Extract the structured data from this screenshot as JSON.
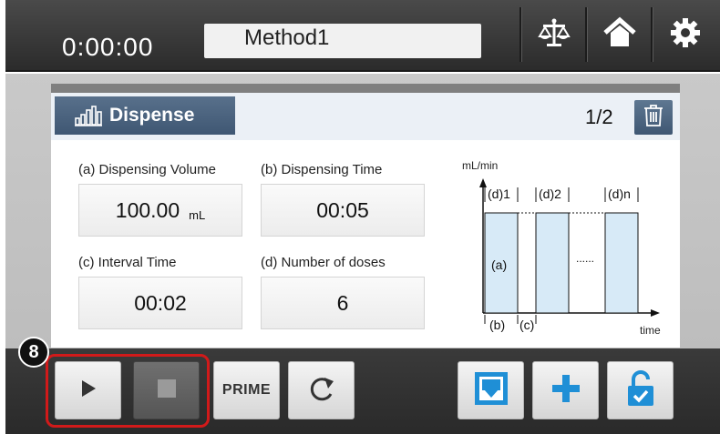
{
  "header": {
    "timer": "0:00:00",
    "method_name": "Method1",
    "icons": [
      "balance-icon",
      "home-icon",
      "gear-icon"
    ]
  },
  "panel": {
    "tab_label": "Dispense",
    "page_indicator": "1/2"
  },
  "params": {
    "dispensing_volume": {
      "label": "(a) Dispensing Volume",
      "value": "100.00",
      "unit": "mL"
    },
    "dispensing_time": {
      "label": "(b) Dispensing Time",
      "value": "00:05"
    },
    "interval_time": {
      "label": "(c) Interval Time",
      "value": "00:02"
    },
    "number_of_doses": {
      "label": "(d) Number of doses",
      "value": "6"
    }
  },
  "diagram": {
    "y_axis_label": "mL/min",
    "x_axis_label": "time",
    "dose_labels": [
      "(d)1",
      "(d)2",
      "(d)n"
    ],
    "volume_label": "(a)",
    "ellipsis": "......",
    "time_label": "(b)",
    "interval_label": "(c)"
  },
  "toolbar": {
    "prime_label": "PRIME",
    "callout_number": "8"
  },
  "colors": {
    "accent": "#3f5773",
    "save_blue": "#1f8fd6",
    "highlight_red": "#d11a1a",
    "bar_fill": "#d7eaf7"
  }
}
